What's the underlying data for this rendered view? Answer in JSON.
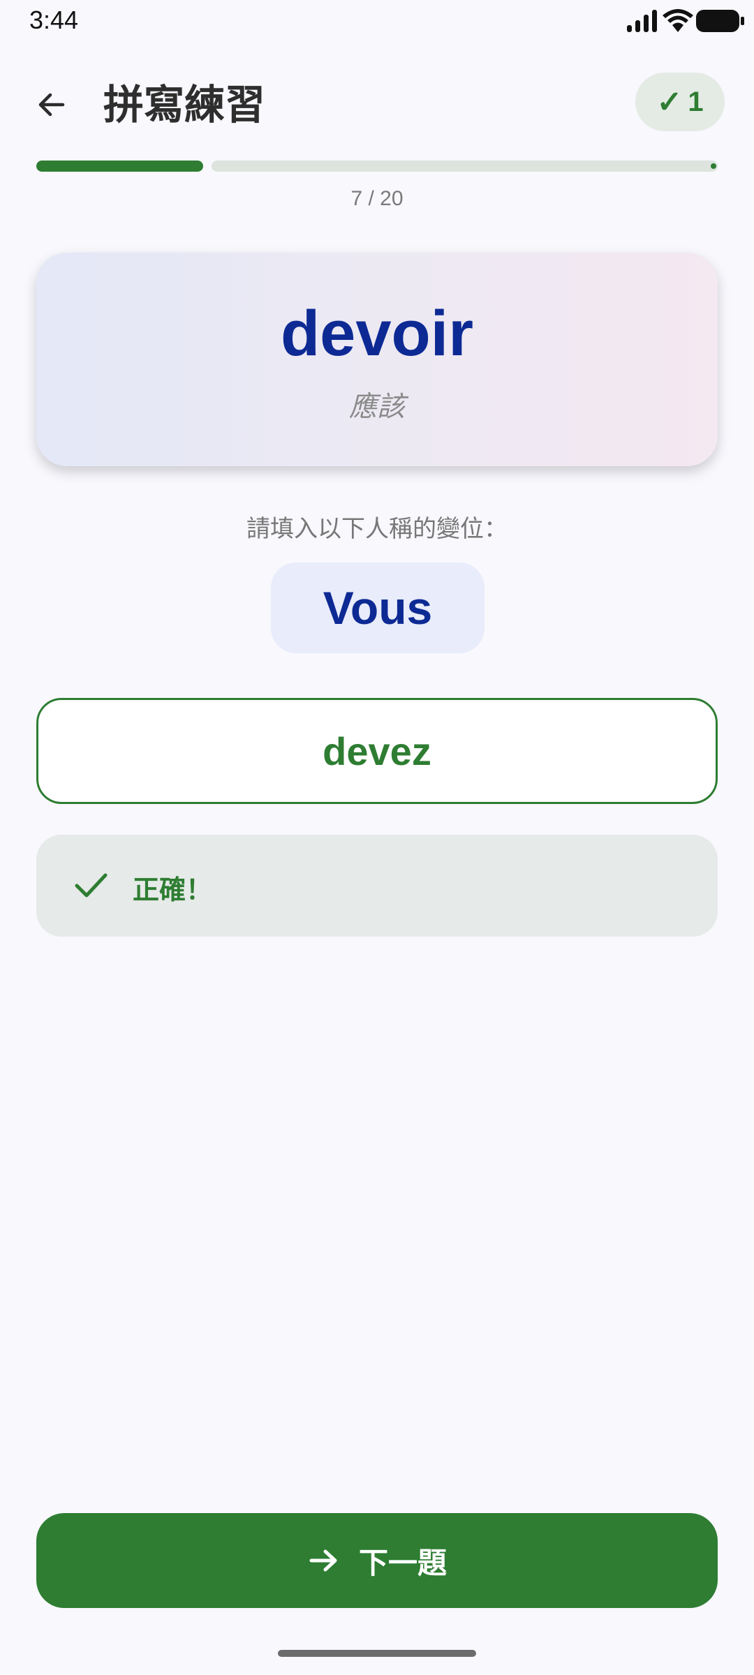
{
  "status_bar": {
    "time": "3:44",
    "icons": [
      "signal-icon",
      "wifi-icon",
      "battery-icon"
    ]
  },
  "header": {
    "title": "拼寫練習",
    "score_badge": "1",
    "score_icon": "check-icon"
  },
  "progress": {
    "current": 7,
    "total": 20,
    "label": "7 / 20"
  },
  "word_card": {
    "word": "devoir",
    "meaning": "應該"
  },
  "prompt": {
    "instruction": "請填入以下人稱的變位：",
    "pronoun": "Vous"
  },
  "answer": {
    "value": "devez"
  },
  "feedback": {
    "text": "正確！",
    "icon": "check-icon"
  },
  "next_button": {
    "label": "下一題",
    "icon": "arrow-right-icon"
  },
  "colors": {
    "accent": "#2e7d32",
    "word_blue": "#0d2a94",
    "background": "#f8f8fd"
  }
}
